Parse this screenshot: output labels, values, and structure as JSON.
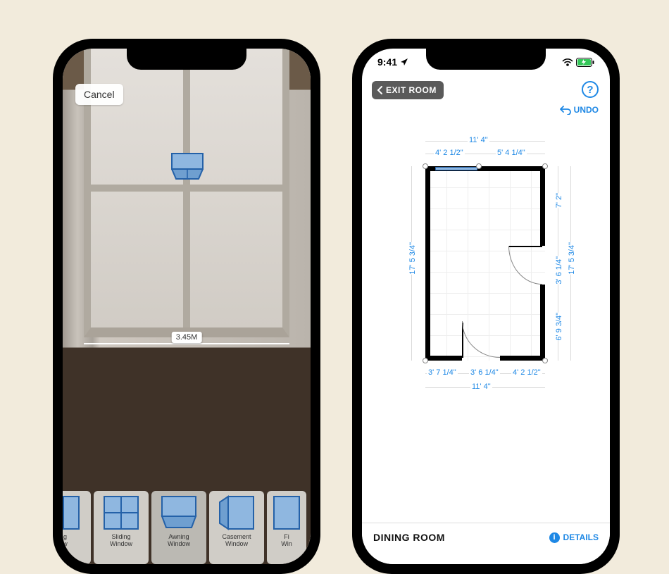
{
  "left": {
    "cancel": "Cancel",
    "measurement": "3.45M",
    "window_options": [
      {
        "line1": "ng",
        "line2": "ow"
      },
      {
        "line1": "Sliding",
        "line2": "Window"
      },
      {
        "line1": "Awning",
        "line2": "Window"
      },
      {
        "line1": "Casement",
        "line2": "Window"
      },
      {
        "line1": "Fi",
        "line2": "Win"
      }
    ]
  },
  "right": {
    "status": {
      "time": "9:41"
    },
    "exit_room": "EXIT ROOM",
    "undo": "UNDO",
    "help": "?",
    "room_name": "DINING ROOM",
    "details_label": "DETAILS",
    "dims": {
      "top_total": "11' 4\"",
      "top_left": "4' 2 1/2\"",
      "top_right": "5' 4 1/4\"",
      "right_top": "7' 2\"",
      "right_mid": "3' 6 1/4\"",
      "right_bot": "6' 9 3/4\"",
      "right_total": "17' 5 3/4\"",
      "left_total": "17' 5 3/4\"",
      "bottom_total": "11' 4\"",
      "bottom_left": "3' 7 1/4\"",
      "bottom_mid": "3' 6 1/4\"",
      "bottom_right": "4' 2 1/2\""
    }
  }
}
